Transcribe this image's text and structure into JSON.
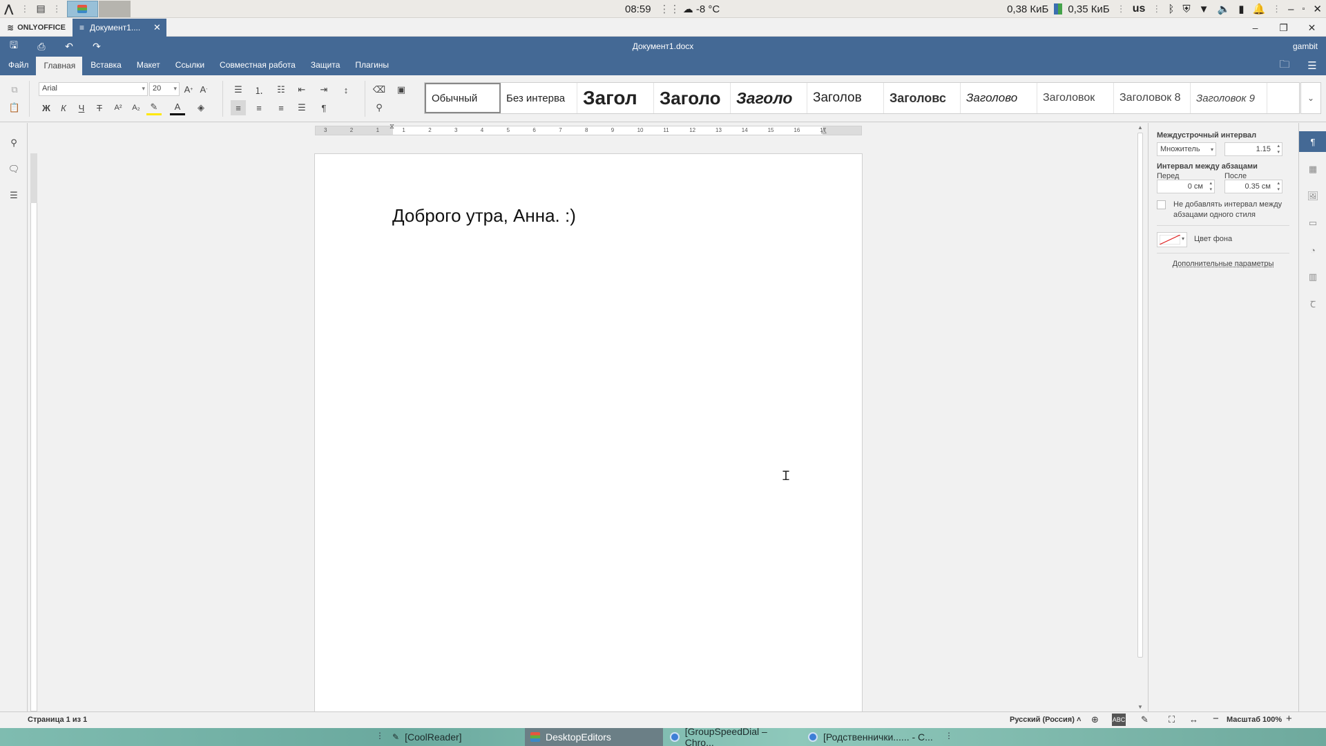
{
  "system_panel": {
    "time": "08:59",
    "weather": "-8 °C",
    "net_down": "0,38 КиБ",
    "net_up": "0,35 КиБ",
    "keyboard_layout": "us"
  },
  "app": {
    "brand": "ONLYOFFICE",
    "tab_title": "Документ1....",
    "doc_title": "Документ1.docx",
    "user": "gambit"
  },
  "menu": {
    "tabs": [
      "Файл",
      "Главная",
      "Вставка",
      "Макет",
      "Ссылки",
      "Совместная работа",
      "Защита",
      "Плагины"
    ],
    "active_tab": "Главная"
  },
  "toolbar": {
    "font_name": "Arial",
    "font_size": "20",
    "bold": "Ж",
    "italic": "К",
    "underline": "Ч",
    "strike": "Т",
    "superscript": "A²",
    "subscript": "A₂",
    "styles": [
      "Обычный",
      "Без интерва",
      "Загол",
      "Заголо",
      "Заголо",
      "Заголов",
      "Заголовс",
      "Заголово",
      "Заголовок",
      "Заголовок 8",
      "Заголовок 9"
    ]
  },
  "document": {
    "text": "Доброго утра, Анна. :)"
  },
  "ruler": {
    "numbers": [
      "3",
      "2",
      "1",
      "1",
      "2",
      "3",
      "4",
      "5",
      "6",
      "7",
      "8",
      "9",
      "10",
      "11",
      "12",
      "13",
      "14",
      "15",
      "16",
      "17"
    ]
  },
  "right_panel": {
    "line_spacing_label": "Междустрочный интервал",
    "line_spacing_mode": "Множитель",
    "line_spacing_value": "1.15",
    "para_spacing_label": "Интервал между абзацами",
    "before_label": "Перед",
    "after_label": "После",
    "before_value": "0 см",
    "after_value": "0.35 см",
    "no_spacing_label": "Не добавлять интервал между абзацами одного стиля",
    "bg_color_label": "Цвет фона",
    "advanced_link": "Дополнительные параметры"
  },
  "statusbar": {
    "page_info": "Страница 1 из 1",
    "language": "Русский (Россия)",
    "zoom": "Масштаб 100%"
  },
  "taskbar": {
    "tasks": [
      "[CoolReader]",
      "DesktopEditors",
      "[GroupSpeedDial – Chro...",
      "[Родственнички...... - С..."
    ]
  },
  "colors": {
    "accent": "#446995",
    "page_bg": "#ffffff",
    "chrome_bg": "#f1f1f1"
  }
}
